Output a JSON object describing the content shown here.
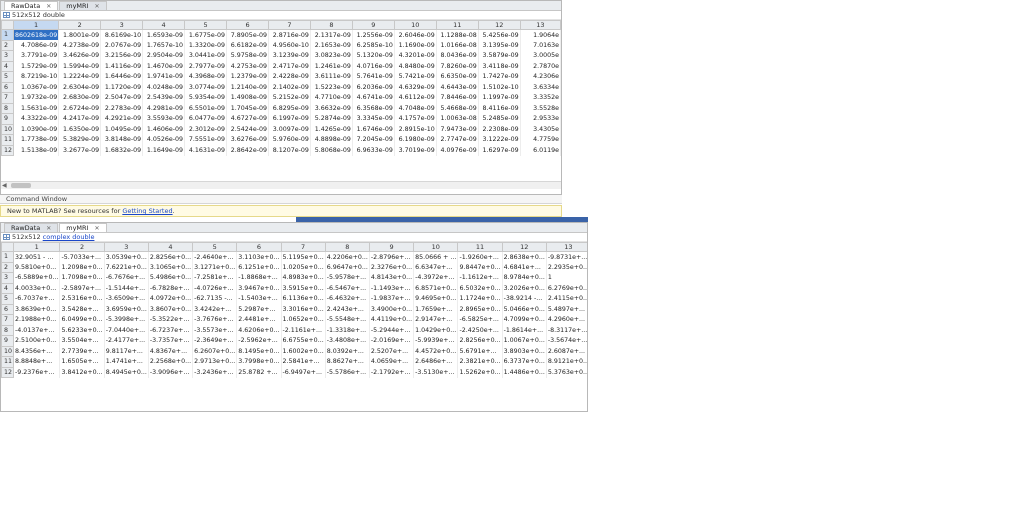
{
  "top": {
    "tabs": [
      {
        "label": "RawData",
        "active": true
      },
      {
        "label": "myMRI",
        "active": false
      }
    ],
    "info": "512x512 double",
    "columns": [
      "1",
      "2",
      "3",
      "4",
      "5",
      "6",
      "7",
      "8",
      "9",
      "10",
      "11",
      "12",
      "13"
    ],
    "rows": [
      {
        "rh": "1",
        "cells": [
          "8602618e-09",
          "1.8001e-09",
          "8.6169e-10",
          "1.6593e-09",
          "1.6775e-09",
          "7.8905e-09",
          "2.8716e-09",
          "2.1317e-09",
          "1.2556e-09",
          "2.6046e-09",
          "1.1288e-08",
          "5.4256e-09",
          "1.9064e"
        ]
      },
      {
        "rh": "2",
        "cells": [
          "4.7086e-09",
          "4.2738e-09",
          "2.0767e-09",
          "1.7657e-10",
          "1.3320e-09",
          "6.6182e-09",
          "4.9560e-10",
          "2.1653e-09",
          "6.2585e-10",
          "1.1690e-09",
          "1.0166e-08",
          "3.1395e-09",
          "7.0163e"
        ]
      },
      {
        "rh": "3",
        "cells": [
          "3.7791e-09",
          "3.4626e-09",
          "3.2156e-09",
          "2.9504e-09",
          "3.0441e-09",
          "5.9758e-09",
          "3.1239e-09",
          "3.0823e-09",
          "5.1320e-09",
          "4.3201e-09",
          "8.0436e-09",
          "3.5879e-09",
          "3.0005e"
        ]
      },
      {
        "rh": "4",
        "cells": [
          "1.5729e-09",
          "1.5994e-09",
          "1.4116e-09",
          "1.4670e-09",
          "2.7977e-09",
          "4.2753e-09",
          "2.4717e-09",
          "1.2461e-09",
          "4.0716e-09",
          "4.8480e-09",
          "7.8260e-09",
          "3.4118e-09",
          "2.7870e"
        ]
      },
      {
        "rh": "5",
        "cells": [
          "8.7219e-10",
          "1.2224e-09",
          "1.6446e-09",
          "1.9741e-09",
          "4.3968e-09",
          "1.2379e-09",
          "2.4228e-09",
          "3.6111e-09",
          "5.7641e-09",
          "5.7421e-09",
          "6.6350e-09",
          "1.7427e-09",
          "4.2306e"
        ]
      },
      {
        "rh": "6",
        "cells": [
          "1.0367e-09",
          "2.6304e-09",
          "1.1720e-09",
          "4.0248e-09",
          "3.0774e-09",
          "1.2140e-09",
          "2.1402e-09",
          "1.5223e-09",
          "6.2036e-09",
          "4.6329e-09",
          "4.6443e-09",
          "1.5102e-10",
          "3.6334e"
        ]
      },
      {
        "rh": "7",
        "cells": [
          "1.9732e-09",
          "2.6830e-09",
          "2.5047e-09",
          "2.5439e-09",
          "5.9354e-09",
          "1.4908e-09",
          "5.2152e-09",
          "4.7710e-09",
          "4.6741e-09",
          "4.6112e-09",
          "7.8446e-09",
          "1.1997e-09",
          "3.3352e"
        ]
      },
      {
        "rh": "8",
        "cells": [
          "1.5631e-09",
          "2.6724e-09",
          "2.2783e-09",
          "4.2981e-09",
          "6.5501e-09",
          "1.7045e-09",
          "6.8295e-09",
          "3.6632e-09",
          "6.3568e-09",
          "4.7048e-09",
          "5.4668e-09",
          "8.4116e-09",
          "3.5528e"
        ]
      },
      {
        "rh": "9",
        "cells": [
          "4.3322e-09",
          "4.2417e-09",
          "4.2921e-09",
          "3.5593e-09",
          "6.0477e-09",
          "4.6727e-09",
          "6.1997e-09",
          "5.2874e-09",
          "3.3345e-09",
          "4.1757e-09",
          "1.0063e-08",
          "5.2485e-09",
          "2.9533e"
        ]
      },
      {
        "rh": "10",
        "cells": [
          "1.0390e-09",
          "1.6350e-09",
          "1.0495e-09",
          "1.4606e-09",
          "2.3012e-09",
          "2.5424e-09",
          "3.0097e-09",
          "1.4265e-09",
          "1.6746e-09",
          "2.8915e-10",
          "7.9473e-09",
          "2.2308e-09",
          "3.4305e"
        ]
      },
      {
        "rh": "11",
        "cells": [
          "1.7738e-09",
          "5.3829e-09",
          "3.8148e-09",
          "4.0526e-09",
          "7.5551e-09",
          "3.6276e-09",
          "5.9760e-09",
          "4.8898e-09",
          "7.2045e-09",
          "6.1980e-09",
          "2.7747e-09",
          "3.1222e-09",
          "4.7759e"
        ]
      },
      {
        "rh": "12",
        "cells": [
          "1.5138e-09",
          "3.2677e-09",
          "1.6832e-09",
          "1.1649e-09",
          "4.1631e-09",
          "2.8642e-09",
          "8.1207e-09",
          "5.8068e-09",
          "6.9633e-09",
          "3.7019e-09",
          "4.0976e-09",
          "1.6297e-09",
          "6.0119e"
        ]
      }
    ]
  },
  "command_window": {
    "title": "Command Window",
    "notice_prefix": "New to MATLAB? See resources for ",
    "notice_link": "Getting Started",
    "notice_suffix": "."
  },
  "bottom": {
    "tabs": [
      {
        "label": "RawData",
        "active": false
      },
      {
        "label": "myMRI",
        "active": true
      }
    ],
    "info_prefix": "512x512 ",
    "info_link": "complex double",
    "columns": [
      "1",
      "2",
      "3",
      "4",
      "5",
      "6",
      "7",
      "8",
      "9",
      "10",
      "11",
      "12",
      "13"
    ],
    "rows": [
      {
        "rh": "1",
        "cells": [
          "32.9051 - ...",
          "-5.7033e+...",
          "3.0539e+0...",
          "2.8256e+0...",
          "-2.4640e+...",
          "3.1103e+0...",
          "5.1195e+0...",
          "4.2206e+0...",
          "-2.8796e+...",
          "85.0666 + ...",
          "-1.9260e+...",
          "2.8638e+0...",
          "-9.8731e+..."
        ],
        "edge": "1"
      },
      {
        "rh": "2",
        "cells": [
          "9.5810e+0...",
          "1.2098e+0...",
          "7.6221e+0...",
          "3.1065e+0...",
          "3.1271e+0...",
          "6.1251e+0...",
          "1.0205e+0...",
          "6.9647e+0...",
          "2.3276e+0...",
          "6.6347e+...",
          "9.8447e+0...",
          "4.6841e+...",
          "2.2935e+0..."
        ],
        "edge": "6"
      },
      {
        "rh": "3",
        "cells": [
          "-6.5889e+0...",
          "1.7098e+0...",
          "-6.7676e+...",
          "5.4986e+0...",
          "-7.2581e+...",
          "-1.8868e+...",
          "4.8983e+0...",
          "-5.9578e+...",
          "4.8143e+0...",
          "-4.3972e+...",
          "-1.1612e+...",
          "8.9784e+0...",
          "1"
        ],
        "edge": ""
      },
      {
        "rh": "4",
        "cells": [
          "4.0033e+0...",
          "-2.5897e+...",
          "-1.5144e+...",
          "-6.7828e+...",
          "-4.0726e+...",
          "3.9467e+0...",
          "3.5915e+0...",
          "-6.5467e+...",
          "-1.1493e+...",
          "6.8571e+0...",
          "6.5032e+0...",
          "3.2026e+0...",
          "6.2769e+0..."
        ],
        "edge": "1"
      },
      {
        "rh": "5",
        "cells": [
          "-6.7037e+...",
          "2.5316e+0...",
          "-3.6509e+...",
          "4.0972e+0...",
          "-62.7135 -...",
          "-1.5403e+...",
          "6.1136e+0...",
          "-6.4632e+...",
          "-1.9837e+...",
          "9.4695e+0...",
          "1.1724e+0...",
          "-38.9214 -...",
          "2.4115e+0..."
        ],
        "edge": "-"
      },
      {
        "rh": "6",
        "cells": [
          "3.8639e+0...",
          "3.5428e+...",
          "3.6959e+0...",
          "3.8607e+0...",
          "3.4242e+...",
          "5.2987e+...",
          "3.3016e+0...",
          "2.4243e+...",
          "3.4900e+0...",
          "1.7659e+...",
          "2.8965e+0...",
          "5.0466e+0...",
          "5.4897e+..."
        ],
        "edge": "-"
      },
      {
        "rh": "7",
        "cells": [
          "2.1988e+0...",
          "6.0499e+0...",
          "-5.3998e+...",
          "-5.3522e+...",
          "-3.7676e+...",
          "2.4481e+...",
          "1.0652e+0...",
          "-5.5548e+...",
          "4.4119e+0...",
          "2.9147e+...",
          "-6.5825e+...",
          "4.7099e+0...",
          "4.2960e+..."
        ],
        "edge": ""
      },
      {
        "rh": "8",
        "cells": [
          "-4.0137e+...",
          "5.6233e+0...",
          "-7.0440e+...",
          "-6.7237e+...",
          "-3.5573e+...",
          "4.6206e+0...",
          "-2.1161e+...",
          "-1.3318e+...",
          "-5.2944e+...",
          "1.0429e+0...",
          "-2.4250e+...",
          "-1.8614e+...",
          "-8.3117e+..."
        ],
        "edge": "2"
      },
      {
        "rh": "9",
        "cells": [
          "2.5100e+0...",
          "3.5504e+...",
          "-2.4177e+...",
          "-3.7357e+...",
          "-2.3649e+...",
          "-2.5962e+...",
          "6.6755e+0...",
          "-3.4808e+...",
          "-2.0169e+...",
          "-5.9939e+...",
          "2.8256e+0...",
          "1.0067e+0...",
          "-3.5674e+..."
        ],
        "edge": "-"
      },
      {
        "rh": "10",
        "cells": [
          "8.4356e+...",
          "2.7739e+...",
          "9.8117e+...",
          "4.8367e+...",
          "6.2607e+0...",
          "8.1495e+0...",
          "1.6002e+0...",
          "8.0392e+...",
          "2.5207e+...",
          "4.4572e+0...",
          "5.6791e+...",
          "3.8903e+0...",
          "2.6087e+..."
        ],
        "edge": "1"
      },
      {
        "rh": "11",
        "cells": [
          "8.8848e+...",
          "1.6505e+...",
          "1.4741e+...",
          "2.2568e+0...",
          "2.9713e+0...",
          "3.7998e+0...",
          "2.5841e+...",
          "8.8627e+...",
          "4.0659e+...",
          "2.6486e+...",
          "2.3821e+0...",
          "6.3737e+0...",
          "8.9121e+0..."
        ],
        "edge": ""
      },
      {
        "rh": "12",
        "cells": [
          "-9.2376e+...",
          "3.8412e+0...",
          "8.4945e+0...",
          "-3.9096e+...",
          "-3.2436e+...",
          "25.8782 +...",
          "-6.9497e+...",
          "-5.5786e+...",
          "-2.1792e+...",
          "-3.5130e+...",
          "1.5262e+0...",
          "1.4486e+0...",
          "5.3763e+0..."
        ],
        "edge": "7"
      }
    ]
  }
}
